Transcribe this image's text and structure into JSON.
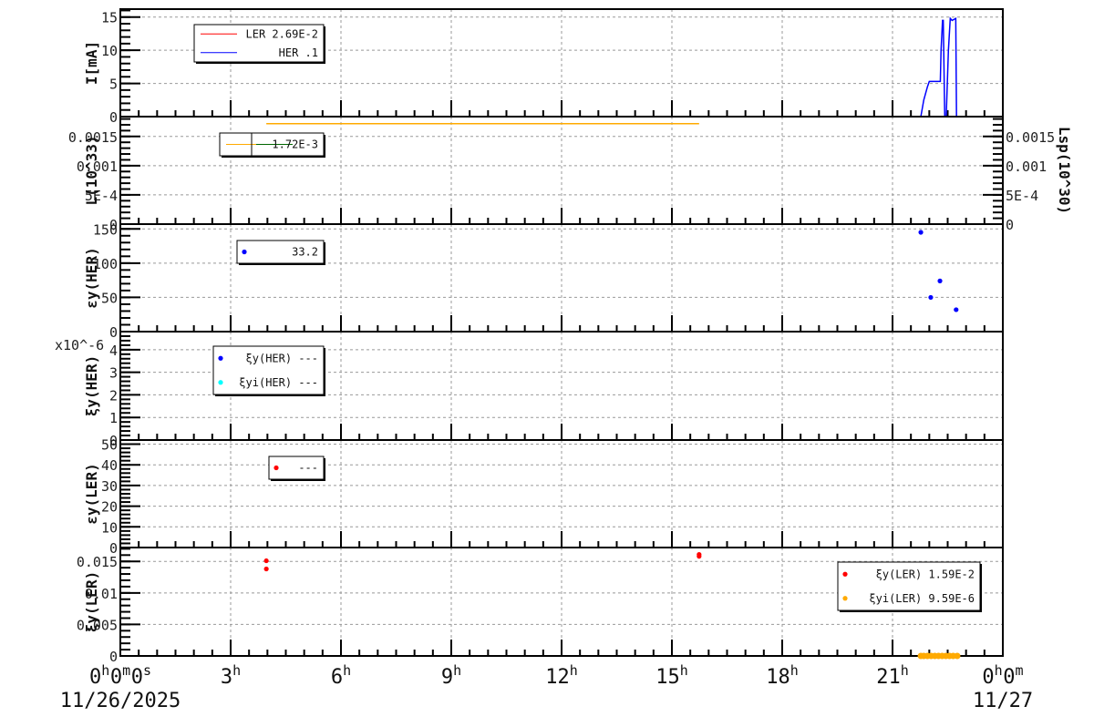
{
  "x_axis": {
    "range_hours": [
      0,
      24
    ],
    "ticks": [
      {
        "h": 0,
        "parts": [
          [
            "0",
            "h"
          ],
          [
            "0",
            "m"
          ],
          [
            "0",
            "s"
          ]
        ]
      },
      {
        "h": 3,
        "parts": [
          [
            "3",
            "h"
          ]
        ]
      },
      {
        "h": 6,
        "parts": [
          [
            "6",
            "h"
          ]
        ]
      },
      {
        "h": 9,
        "parts": [
          [
            "9",
            "h"
          ]
        ]
      },
      {
        "h": 12,
        "parts": [
          [
            "12",
            "h"
          ]
        ]
      },
      {
        "h": 15,
        "parts": [
          [
            "15",
            "h"
          ]
        ]
      },
      {
        "h": 18,
        "parts": [
          [
            "18",
            "h"
          ]
        ]
      },
      {
        "h": 21,
        "parts": [
          [
            "21",
            "h"
          ]
        ]
      },
      {
        "h": 24,
        "parts": [
          [
            "0",
            "h"
          ],
          [
            "0",
            "m"
          ]
        ]
      }
    ],
    "start_date": "11/26/2025",
    "end_date": "11/27"
  },
  "colors": {
    "ler": "#ff0000",
    "her": "#0000ff",
    "orange": "#ffaa00",
    "cyan": "#00ffff",
    "green": "#006600"
  },
  "chart_data": [
    {
      "type": "line",
      "ylabel": "I[mA]",
      "ylim": [
        0,
        16.2
      ],
      "yticks": [
        0,
        5,
        10,
        15
      ],
      "ytick_labels": [
        "0",
        "5",
        "10",
        "15"
      ],
      "legend": [
        {
          "label": "LER  2.69E-2",
          "color": "#ff0000",
          "kind": "line"
        },
        {
          "label": "HER       .1",
          "color": "#0000ff",
          "kind": "line"
        }
      ],
      "series": [
        {
          "name": "LER",
          "color": "#ff0000",
          "x": [
            18.1,
            24
          ],
          "y": [
            0,
            0
          ]
        },
        {
          "name": "HER",
          "color": "#0000ff",
          "x": [
            0,
            21.77,
            21.85,
            21.95,
            22.0,
            22.3,
            22.32,
            22.36,
            22.38,
            22.42,
            22.46,
            22.52,
            22.57,
            22.62,
            22.72,
            22.74,
            24
          ],
          "y": [
            0,
            0,
            2.5,
            4.5,
            5.3,
            5.3,
            10,
            14.5,
            14.5,
            0,
            0,
            10,
            14.8,
            14.5,
            14.8,
            0,
            0
          ]
        }
      ]
    },
    {
      "type": "line",
      "ylabel": "L(10^33)",
      "ylabel_right": "Lsp(10^30)",
      "ylim": [
        0,
        0.00184
      ],
      "yticks": [
        0,
        0.0005,
        0.001,
        0.0015
      ],
      "ytick_labels": [
        "0",
        "5E-4",
        "0.001",
        "0.0015"
      ],
      "legend": [
        {
          "label": "1.72E-3",
          "color": "#ffaa00",
          "kind": "line"
        }
      ],
      "series": [
        {
          "name": "L",
          "color": "#ffaa00",
          "x": [
            3.97,
            15.74
          ],
          "y": [
            0.00172,
            0.00172
          ]
        }
      ]
    },
    {
      "type": "scatter",
      "ylabel": "εy(HER)",
      "ylim": [
        0,
        157
      ],
      "yticks": [
        0,
        50,
        100,
        150
      ],
      "ytick_labels": [
        "0",
        "50",
        "100",
        "150"
      ],
      "legend": [
        {
          "label": "33.2",
          "color": "#0000ff",
          "kind": "dot"
        }
      ],
      "series": [
        {
          "name": "εy(HER)",
          "color": "#0000ff",
          "x": [
            21.77,
            22.04,
            22.29,
            22.73
          ],
          "y": [
            145,
            50,
            74,
            32
          ]
        }
      ]
    },
    {
      "type": "scatter",
      "ylabel": "ξy(HER)",
      "multiplier": "x10^-6",
      "ylim": [
        0,
        4.8
      ],
      "yticks": [
        0,
        1,
        2,
        3,
        4
      ],
      "ytick_labels": [
        "0",
        "1",
        "2",
        "3",
        "4"
      ],
      "legend": [
        {
          "label": "ξy(HER) ---",
          "color": "#0000ff",
          "kind": "dot"
        },
        {
          "label": "ξyi(HER) ---",
          "color": "#00ffff",
          "kind": "dot"
        }
      ],
      "series": []
    },
    {
      "type": "scatter",
      "ylabel": "εy(LER)",
      "ylim": [
        0,
        52
      ],
      "yticks": [
        0,
        10,
        20,
        30,
        40,
        50
      ],
      "ytick_labels": [
        "0",
        "10",
        "20",
        "30",
        "40",
        "50"
      ],
      "legend": [
        {
          "label": "---",
          "color": "#ff0000",
          "kind": "dot"
        }
      ],
      "series": []
    },
    {
      "type": "scatter",
      "ylabel": "ξy(LER)",
      "ylim": [
        0,
        0.0172
      ],
      "yticks": [
        0,
        0.005,
        0.01,
        0.015
      ],
      "ytick_labels": [
        "0",
        "0.005",
        "0.01",
        "0.015"
      ],
      "legend": [
        {
          "label": "ξy(LER)  1.59E-2",
          "color": "#ff0000",
          "kind": "dot"
        },
        {
          "label": "ξyi(LER)  9.59E-6",
          "color": "#ffaa00",
          "kind": "dot"
        }
      ],
      "series": [
        {
          "name": "ξy(LER)",
          "color": "#ff0000",
          "x": [
            3.97,
            3.97,
            15.74,
            15.74
          ],
          "y": [
            0.0151,
            0.0138,
            0.0161,
            0.0158
          ]
        },
        {
          "name": "ξyi(LER)",
          "color": "#ffaa00",
          "x": [
            21.77,
            21.85,
            21.95,
            22.05,
            22.15,
            22.25,
            22.35,
            22.45,
            22.55,
            22.65,
            22.76
          ],
          "y": [
            0,
            0,
            0,
            0,
            0,
            0,
            0,
            0,
            0,
            0,
            0
          ]
        }
      ]
    }
  ]
}
